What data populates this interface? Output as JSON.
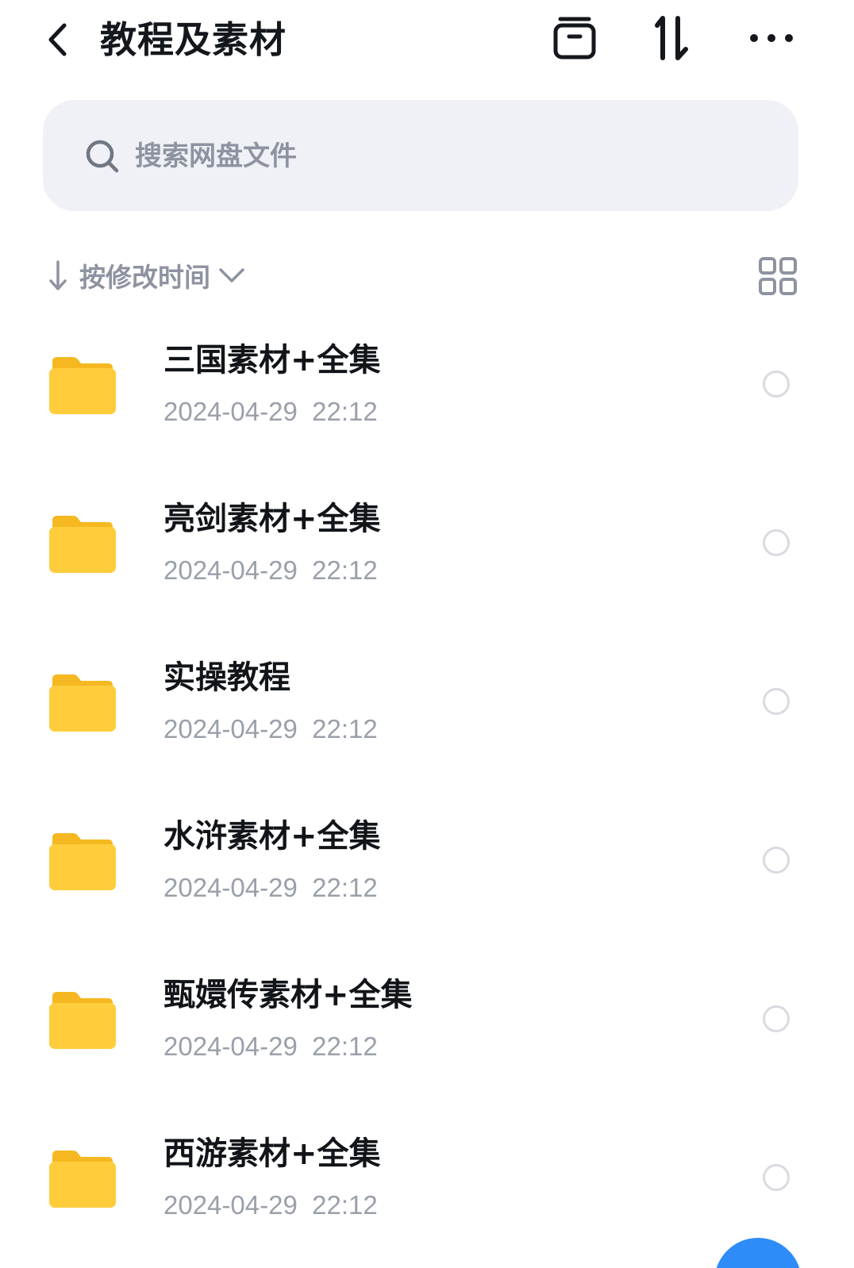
{
  "header": {
    "title": "教程及素材"
  },
  "search": {
    "placeholder": "搜索网盘文件"
  },
  "sortbar": {
    "label": "按修改时间"
  },
  "files": [
    {
      "name": "三国素材+全集",
      "modified": "2024-04-29  22:12"
    },
    {
      "name": "亮剑素材+全集",
      "modified": "2024-04-29  22:12"
    },
    {
      "name": "实操教程",
      "modified": "2024-04-29  22:12"
    },
    {
      "name": "水浒素材+全集",
      "modified": "2024-04-29  22:12"
    },
    {
      "name": "甄嬛传素材+全集",
      "modified": "2024-04-29  22:12"
    },
    {
      "name": "西游素材+全集",
      "modified": "2024-04-29  22:12"
    }
  ],
  "colors": {
    "folder": "#ffcd3c",
    "accent": "#2e8cf8",
    "muted_text": "#9aa0aa",
    "search_bg": "#eff1f6"
  },
  "icons": [
    "back-arrow-icon",
    "archive-box-icon",
    "sort-icon",
    "more-icon",
    "search-icon",
    "sort-down-arrow-icon",
    "chevron-down-icon",
    "grid-view-icon",
    "folder-icon"
  ]
}
